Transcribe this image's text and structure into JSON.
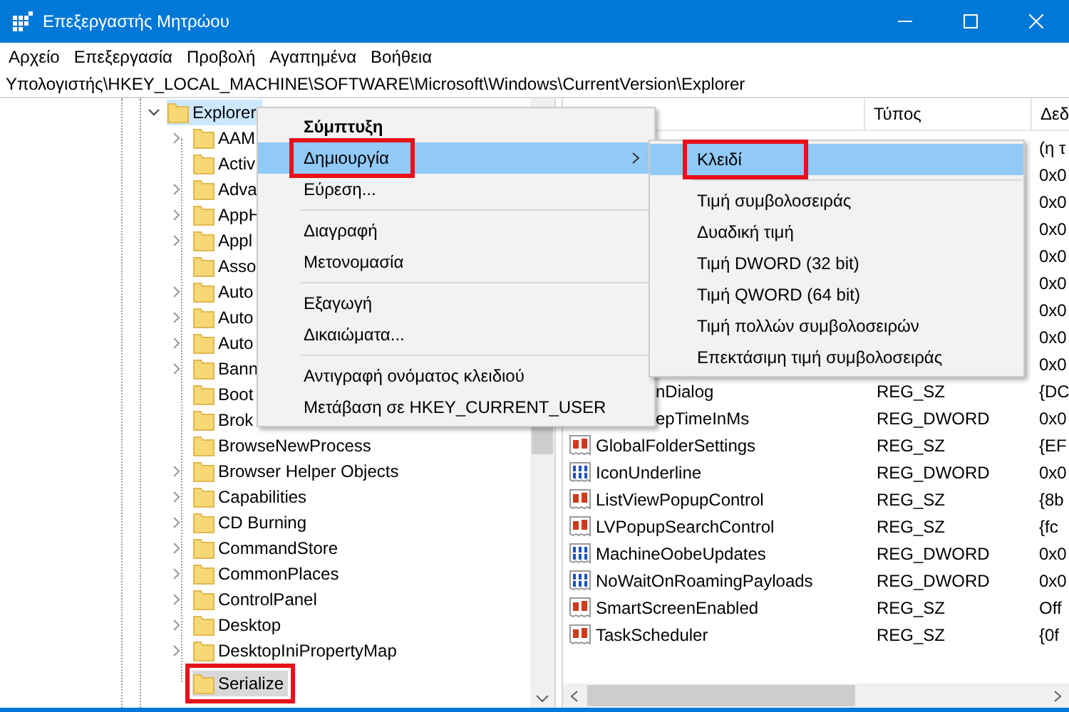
{
  "window": {
    "title": "Επεξεργαστής Μητρώου"
  },
  "menu_bar": [
    "Αρχείο",
    "Επεξεργασία",
    "Προβολή",
    "Αγαπημένα",
    "Βοήθεια"
  ],
  "address_bar": "Υπολογιστής\\HKEY_LOCAL_MACHINE\\SOFTWARE\\Microsoft\\Windows\\CurrentVersion\\Explorer",
  "tree": {
    "label": "Explorer",
    "expanded": true,
    "hot": true,
    "children": [
      {
        "label": "AAM",
        "expandable": true,
        "selected": false
      },
      {
        "label": "Activ",
        "expandable": false,
        "selected": false
      },
      {
        "label": "Adva",
        "expandable": true,
        "selected": false
      },
      {
        "label": "AppH",
        "expandable": true,
        "selected": false
      },
      {
        "label": "Appl",
        "expandable": true,
        "selected": false
      },
      {
        "label": "Asso",
        "expandable": false,
        "selected": false
      },
      {
        "label": "Auto",
        "expandable": true,
        "selected": false
      },
      {
        "label": "Auto",
        "expandable": true,
        "selected": false
      },
      {
        "label": "Auto",
        "expandable": true,
        "selected": false
      },
      {
        "label": "Bann",
        "expandable": true,
        "selected": false
      },
      {
        "label": "Boot",
        "expandable": false,
        "selected": false
      },
      {
        "label": "Brok",
        "expandable": false,
        "selected": false
      },
      {
        "label": "BrowseNewProcess",
        "expandable": false,
        "selected": false
      },
      {
        "label": "Browser Helper Objects",
        "expandable": true,
        "selected": false
      },
      {
        "label": "Capabilities",
        "expandable": true,
        "selected": false
      },
      {
        "label": "CD Burning",
        "expandable": true,
        "selected": false
      },
      {
        "label": "CommandStore",
        "expandable": true,
        "selected": false
      },
      {
        "label": "CommonPlaces",
        "expandable": true,
        "selected": false
      },
      {
        "label": "ControlPanel",
        "expandable": true,
        "selected": false
      },
      {
        "label": "Desktop",
        "expandable": true,
        "selected": false
      },
      {
        "label": "DesktopIniPropertyMap",
        "expandable": true,
        "selected": false
      },
      {
        "label": "Serialize",
        "expandable": false,
        "selected": true,
        "annotated": true
      }
    ]
  },
  "table": {
    "columns": [
      "Τύπος",
      "Δεδ"
    ],
    "rows": [
      {
        "kind": "hidden",
        "data": "(η τ"
      },
      {
        "kind": "hidden",
        "data": "0x0"
      },
      {
        "kind": "hidden",
        "data": "0x0"
      },
      {
        "kind": "hidden",
        "data": "0x0"
      },
      {
        "kind": "hidden",
        "data": "0x0"
      },
      {
        "kind": "hidden",
        "data": "0x0"
      },
      {
        "kind": "hidden",
        "data": "0x0"
      },
      {
        "kind": "hidden",
        "data": "0x0"
      },
      {
        "kind": "hidden",
        "data": "0x0"
      },
      {
        "kind": "cut",
        "name": "nDialog",
        "type": "REG_SZ",
        "data": "{DC"
      },
      {
        "kind": "cut",
        "name": "epTimeInMs",
        "type": "REG_DWORD",
        "data": "0x0"
      },
      {
        "kind": "string",
        "name": "GlobalFolderSettings",
        "type": "REG_SZ",
        "data": "{EF"
      },
      {
        "kind": "binary",
        "name": "IconUnderline",
        "type": "REG_DWORD",
        "data": "0x0"
      },
      {
        "kind": "string",
        "name": "ListViewPopupControl",
        "type": "REG_SZ",
        "data": "{8b"
      },
      {
        "kind": "string",
        "name": "LVPopupSearchControl",
        "type": "REG_SZ",
        "data": "{fc"
      },
      {
        "kind": "binary",
        "name": "MachineOobeUpdates",
        "type": "REG_DWORD",
        "data": "0x0"
      },
      {
        "kind": "binary",
        "name": "NoWaitOnRoamingPayloads",
        "type": "REG_DWORD",
        "data": "0x0"
      },
      {
        "kind": "string",
        "name": "SmartScreenEnabled",
        "type": "REG_SZ",
        "data": "Off"
      },
      {
        "kind": "string",
        "name": "TaskScheduler",
        "type": "REG_SZ",
        "data": "{0f"
      }
    ]
  },
  "context_menu": [
    {
      "kind": "item",
      "label": "Σύμπτυξη",
      "default": true,
      "selected": false
    },
    {
      "kind": "item",
      "label": "Δημιουργία",
      "submenu": true,
      "selected": true,
      "annotated": true
    },
    {
      "kind": "item",
      "label": "Εύρεση...",
      "selected": false
    },
    {
      "kind": "separator"
    },
    {
      "kind": "item",
      "label": "Διαγραφή",
      "selected": false
    },
    {
      "kind": "item",
      "label": "Μετονομασία",
      "selected": false
    },
    {
      "kind": "separator"
    },
    {
      "kind": "item",
      "label": "Εξαγωγή",
      "selected": false
    },
    {
      "kind": "item",
      "label": "Δικαιώματα...",
      "selected": false
    },
    {
      "kind": "separator"
    },
    {
      "kind": "item",
      "label": "Αντιγραφή ονόματος κλειδιού",
      "selected": false
    },
    {
      "kind": "item",
      "label": "Μετάβαση σε HKEY_CURRENT_USER",
      "selected": false
    }
  ],
  "submenu": [
    {
      "kind": "item",
      "label": "Κλειδί",
      "selected": true,
      "annotated": true
    },
    {
      "kind": "separator"
    },
    {
      "kind": "item",
      "label": "Τιμή συμβολοσειράς",
      "selected": false
    },
    {
      "kind": "item",
      "label": "Δυαδική τιμή",
      "selected": false
    },
    {
      "kind": "item",
      "label": "Τιμή DWORD (32 bit)",
      "selected": false
    },
    {
      "kind": "item",
      "label": "Τιμή QWORD (64 bit)",
      "selected": false
    },
    {
      "kind": "item",
      "label": "Τιμή πολλών συμβολοσειρών",
      "selected": false
    },
    {
      "kind": "item",
      "label": "Επεκτάσιμη τιμή συμβολοσειράς",
      "selected": false
    }
  ]
}
